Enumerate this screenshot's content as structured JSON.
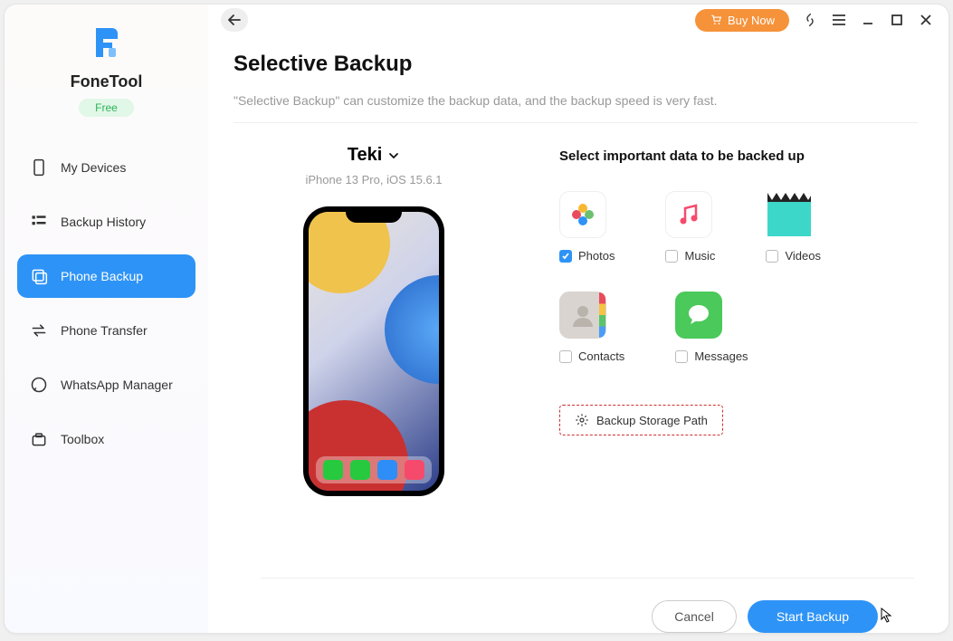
{
  "app": {
    "name": "FoneTool",
    "tier": "Free"
  },
  "titlebar": {
    "buy_now": "Buy Now"
  },
  "sidebar": {
    "items": [
      {
        "label": "My Devices"
      },
      {
        "label": "Backup History"
      },
      {
        "label": "Phone Backup"
      },
      {
        "label": "Phone Transfer"
      },
      {
        "label": "WhatsApp Manager"
      },
      {
        "label": "Toolbox"
      }
    ]
  },
  "page": {
    "title": "Selective Backup",
    "subtitle": "\"Selective Backup\" can customize the backup data, and the backup speed is very fast."
  },
  "device": {
    "name": "Teki",
    "model": "iPhone 13 Pro, iOS 15.6.1"
  },
  "select": {
    "heading": "Select important data to be backed up"
  },
  "options": {
    "photos": {
      "label": "Photos",
      "checked": true
    },
    "music": {
      "label": "Music",
      "checked": false
    },
    "videos": {
      "label": "Videos",
      "checked": false
    },
    "contacts": {
      "label": "Contacts",
      "checked": false
    },
    "messages": {
      "label": "Messages",
      "checked": false
    }
  },
  "storage_path": {
    "label": "Backup Storage Path"
  },
  "footer": {
    "cancel": "Cancel",
    "start": "Start Backup"
  }
}
